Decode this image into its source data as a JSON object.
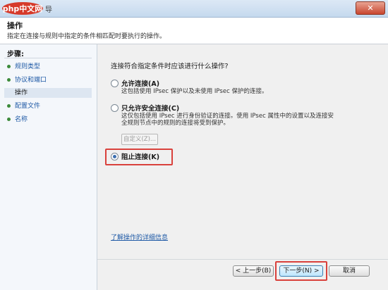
{
  "window": {
    "logo_text": "php中文网",
    "title_suffix": "导",
    "close_label": "✕"
  },
  "header": {
    "title": "操作",
    "description": "指定在连接与规则中指定的条件相匹配时要执行的操作。"
  },
  "sidebar": {
    "heading": "步骤:",
    "items": [
      {
        "label": "规则类型",
        "current": false
      },
      {
        "label": "协议和端口",
        "current": false
      },
      {
        "label": "操作",
        "current": true
      },
      {
        "label": "配置文件",
        "current": false
      },
      {
        "label": "名称",
        "current": false
      }
    ]
  },
  "main": {
    "question": "连接符合指定条件时应该进行什么操作?",
    "options": [
      {
        "label": "允许连接(A)",
        "description": [
          "这包括使用 IPsec 保护以及未使用 IPsec 保护的连接。"
        ],
        "selected": false
      },
      {
        "label": "只允许安全连接(C)",
        "description": [
          "这仅包括使用 IPsec 进行身份验证的连接。使用 IPsec 属性中的设置以及连接安",
          "全规则节点中的规则的连接将受到保护。"
        ],
        "selected": false
      },
      {
        "label": "阻止连接(K)",
        "description": [],
        "selected": true
      }
    ],
    "customize_label": "自定义(Z)...",
    "learn_more": "了解操作的详细信息"
  },
  "footer": {
    "back": "< 上一步(B)",
    "next": "下一步(N) >",
    "cancel": "取消"
  },
  "colors": {
    "highlight": "#d9413c",
    "link": "#1f5aa6",
    "step_dot": "#3c8a3a"
  }
}
